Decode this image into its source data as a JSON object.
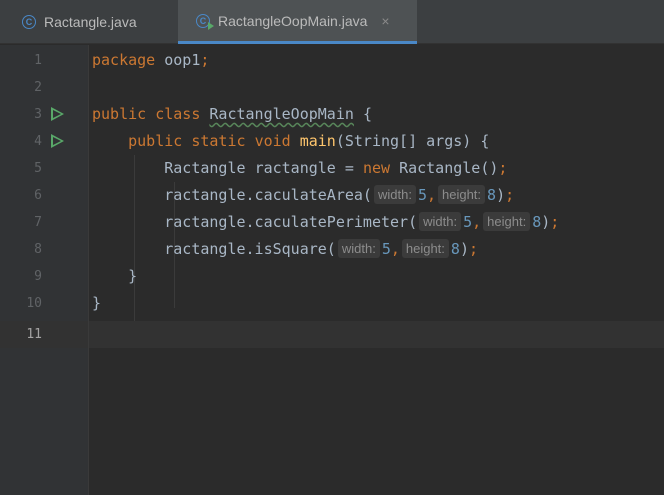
{
  "tabs": [
    {
      "label": "Ractangle.java",
      "icon": "C",
      "active": false
    },
    {
      "label": "RactangleOopMain.java",
      "icon": "C",
      "active": true,
      "close": "×"
    }
  ],
  "lines": [
    {
      "num": "1"
    },
    {
      "num": "2"
    },
    {
      "num": "3"
    },
    {
      "num": "4"
    },
    {
      "num": "5"
    },
    {
      "num": "6"
    },
    {
      "num": "7"
    },
    {
      "num": "8"
    },
    {
      "num": "9"
    },
    {
      "num": "10"
    },
    {
      "num": "11"
    }
  ],
  "code": {
    "l1": {
      "kw": "package",
      "pkg": "oop1",
      "semi": ";"
    },
    "l3": {
      "kw1": "public",
      "kw2": "class",
      "cls": "RactangleOopMain",
      "brace": "{"
    },
    "l4": {
      "kw1": "public",
      "kw2": "static",
      "kw3": "void",
      "fn": "main",
      "args": "(String[] args)",
      "brace": "{"
    },
    "l5": {
      "type": "Ractangle",
      "var": "ractangle",
      "eq": "=",
      "kw": "new",
      "ctor": "Ractangle()",
      "semi": ";"
    },
    "l6": {
      "call": "ractangle.caculateArea(",
      "hint1": "width:",
      "v1": "5",
      "comma": ",",
      "hint2": "height:",
      "v2": "8",
      "end": ")",
      "semi": ";"
    },
    "l7": {
      "call": "ractangle.caculatePerimeter(",
      "hint1": "width:",
      "v1": "5",
      "comma": ",",
      "hint2": "height:",
      "v2": "8",
      "end": ")",
      "semi": ";"
    },
    "l8": {
      "call": "ractangle.isSquare(",
      "hint1": "width:",
      "v1": "5",
      "comma": ",",
      "hint2": "height:",
      "v2": "8",
      "end": ")",
      "semi": ";"
    },
    "l9": {
      "brace": "}"
    },
    "l10": {
      "brace": "}"
    }
  },
  "colors": {
    "keyword": "#cc7832",
    "function": "#ffc66d",
    "number": "#6897bb",
    "text": "#a9b7c6",
    "run": "#59a869",
    "accent": "#4a88c7"
  }
}
